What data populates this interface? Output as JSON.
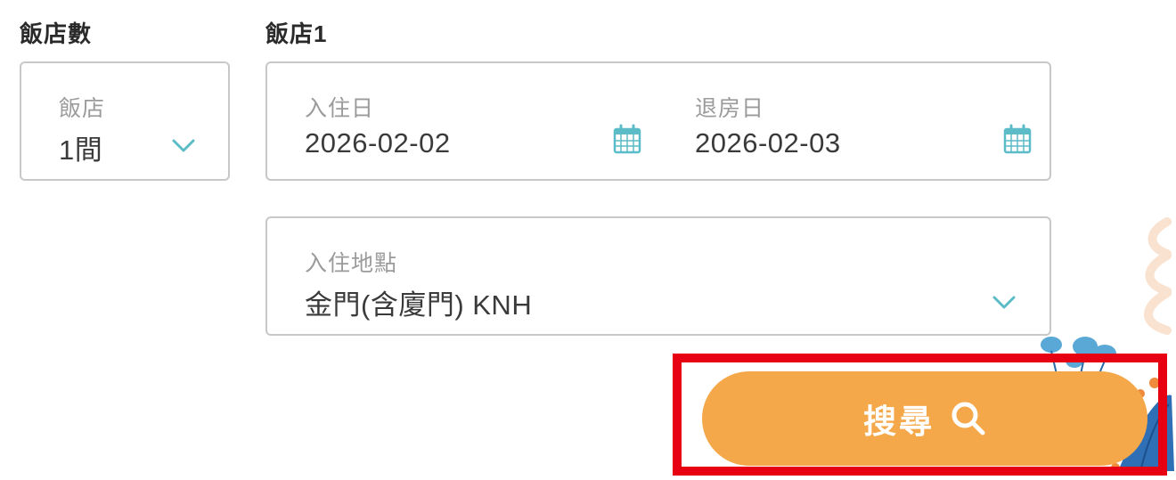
{
  "rooms": {
    "section_title": "飯店數",
    "label": "飯店",
    "value": "1間",
    "dropdown_icon": "chevron-down-icon"
  },
  "hotel": {
    "section_title": "飯店1",
    "checkin": {
      "label": "入住日",
      "value": "2026-02-02",
      "icon": "calendar-icon"
    },
    "checkout": {
      "label": "退房日",
      "value": "2026-02-03",
      "icon": "calendar-icon"
    },
    "location": {
      "label": "入住地點",
      "value": "金門(含廈門) KNH",
      "dropdown_icon": "chevron-down-icon"
    }
  },
  "search": {
    "label": "搜尋",
    "icon": "search-icon"
  },
  "colors": {
    "accent_teal": "#5bbcc7",
    "button_orange": "#f5a84a",
    "highlight_red": "#e60012",
    "border_gray": "#c8c8c8",
    "label_gray": "#9b9b9b"
  }
}
